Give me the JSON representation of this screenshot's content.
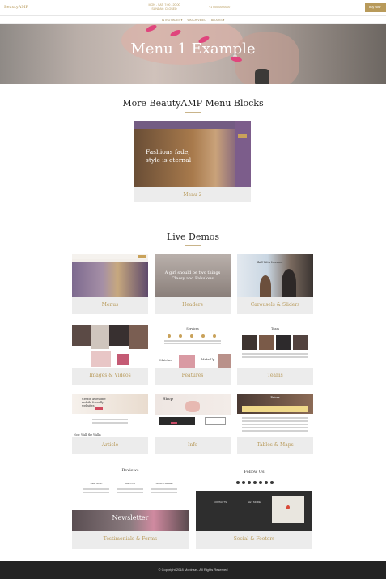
{
  "header": {
    "brand": "BeautyAMP",
    "hours_line1": "MON - SAT: 7:00 - 20:00",
    "hours_line2": "SUNDAY: CLOSED",
    "phone": "+1 000-0000000",
    "buy_label": "Buy Now",
    "nav": [
      "INTRO PAGES ▾",
      "WATCH VIDEO",
      "BLOCKS ▾"
    ]
  },
  "hero": {
    "title": "Menu 1 Example"
  },
  "more_blocks": {
    "title": "More BeautyAMP Menu Blocks",
    "card": {
      "label": "Menu 2",
      "headline_line1": "Fashions fade,",
      "headline_line2": "style is eternal"
    }
  },
  "live_demos": {
    "title": "Live Demos",
    "cards": [
      {
        "label": "Menus"
      },
      {
        "label": "Headers",
        "tagline_line1": "A girl should be two things",
        "tagline_line2": "Classy and Fabulous"
      },
      {
        "label": "Carousels & Sliders",
        "tagline": "Skill With Lessons"
      },
      {
        "label": "Images & Videos"
      },
      {
        "label": "Features",
        "heading": "Services",
        "side_text_1": "Matches",
        "side_text_2": "Make Up"
      },
      {
        "label": "Teams",
        "heading": "Team"
      },
      {
        "label": "Article",
        "headline": "Create awesome mobile friendly websites",
        "subline": "Now, Walk the Walks"
      },
      {
        "label": "Info",
        "headline": "Shop"
      },
      {
        "label": "Tables & Maps",
        "heading": "Prices"
      },
      {
        "label": "Testimonials & Forms",
        "heading": "Reviews",
        "names": [
          "Kate Smith",
          "Max Line",
          "Jessica Stewart"
        ],
        "newsletter": "Newsletter"
      },
      {
        "label": "Social & Footers",
        "heading": "Follow Us",
        "col1": "CONTACTS",
        "col2": "GET MORE"
      }
    ]
  },
  "footer": {
    "text": "© Copyright 2018 Mobirise - All Rights Reserved"
  },
  "colors": {
    "accent": "#b89a5a",
    "footer_bg": "#232323",
    "card_bg": "#ececec"
  }
}
